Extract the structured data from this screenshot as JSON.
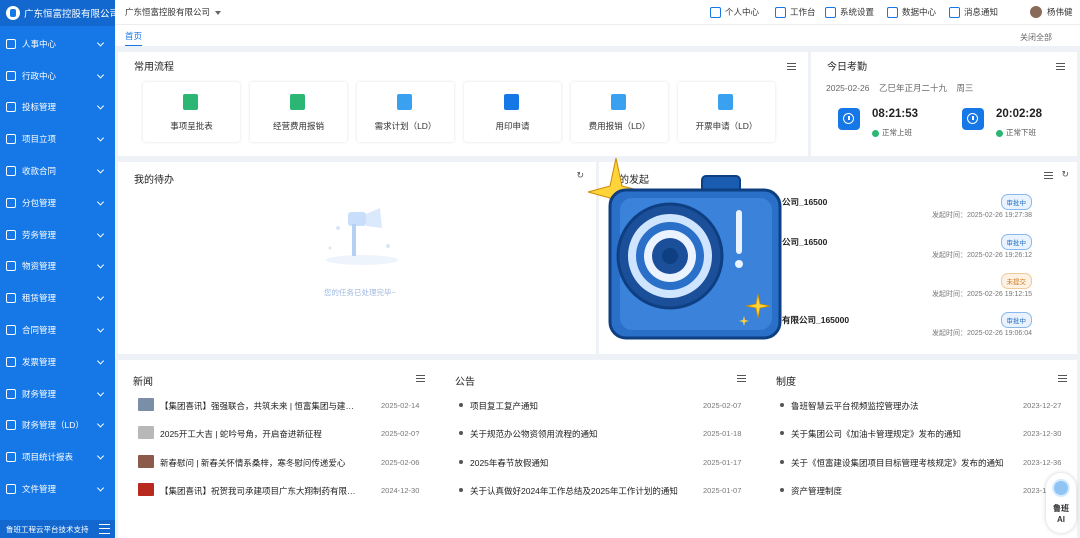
{
  "sidebar": {
    "org_title": "广东恒富控股有限公司",
    "items": [
      {
        "label": "人事中心",
        "icon": "person-icon"
      },
      {
        "label": "行政中心",
        "icon": "admin-icon"
      },
      {
        "label": "投标管理",
        "icon": "bid-icon"
      },
      {
        "label": "项目立项",
        "icon": "project-icon"
      },
      {
        "label": "收款合同",
        "icon": "contract-icon"
      },
      {
        "label": "分包管理",
        "icon": "subcontract-icon"
      },
      {
        "label": "劳务管理",
        "icon": "labor-icon"
      },
      {
        "label": "物资管理",
        "icon": "materials-icon"
      },
      {
        "label": "租赁管理",
        "icon": "lease-icon"
      },
      {
        "label": "合同管理",
        "icon": "contract-mgmt-icon"
      },
      {
        "label": "发票管理",
        "icon": "invoice-icon"
      },
      {
        "label": "财务管理",
        "icon": "finance-icon"
      },
      {
        "label": "财务管理（LD）",
        "icon": "finance-ld-icon"
      },
      {
        "label": "项目统计报表",
        "icon": "report-icon"
      },
      {
        "label": "文件管理",
        "icon": "file-icon"
      }
    ],
    "footer": "鲁班工程云平台技术支持"
  },
  "topbar": {
    "company": "广东恒富控股有限公司",
    "nav": [
      "个人中心",
      "工作台",
      "系统设置",
      "数据中心",
      "消息通知"
    ],
    "user": "杨伟健"
  },
  "tabs": {
    "home": "首页",
    "close_all": "关闭全部"
  },
  "processes": {
    "title": "常用流程",
    "items": [
      {
        "label": "事项呈批表",
        "color": "#2bb673"
      },
      {
        "label": "经营费用报销",
        "color": "#2bb673"
      },
      {
        "label": "需求计划（LD）",
        "color": "#3aa0f0"
      },
      {
        "label": "用印申请",
        "color": "#1677e6"
      },
      {
        "label": "费用报销（LD）",
        "color": "#3aa0f0"
      },
      {
        "label": "开票申请（LD）",
        "color": "#3aa0f0"
      }
    ]
  },
  "attendance": {
    "title": "今日考勤",
    "date": "2025-02-26",
    "lunar": "乙巳年正月二十九",
    "weekday": "周三",
    "checkin": {
      "time": "08:21:53",
      "status": "正常上班"
    },
    "checkout": {
      "time": "20:02:28",
      "status": "正常下班"
    }
  },
  "todo": {
    "title": "我的待办",
    "empty": "您的任务已处理完毕~"
  },
  "sent": {
    "title_visible": "的发起",
    "rows": [
      {
        "title": "公司_16500",
        "badge": "审批中",
        "badge_type": "normal",
        "time": "发起时间：2025-02-26 19:27:38"
      },
      {
        "title": "公司_16500",
        "badge": "审批中",
        "badge_type": "normal",
        "time": "发起时间：2025-02-26 19:26:12"
      },
      {
        "title": "",
        "badge": "未提交",
        "badge_type": "warn",
        "time": "发起时间：2025-02-26 19:12:15"
      },
      {
        "title": "有限公司_165000",
        "badge": "审批中",
        "badge_type": "normal",
        "time": "发起时间：2025-02-26 19:06:04"
      }
    ]
  },
  "news": {
    "title": "新闻",
    "rows": [
      {
        "text": "【集团喜讯】强强联合，共筑未来 | 恒富集团与建成资...",
        "date": "2025-02-14",
        "thumb": "#7a8ea8"
      },
      {
        "text": "2025开工大吉 | 蛇吟号角，开启奋进新征程",
        "date": "2025-02-0?",
        "thumb": "#b8b8b8"
      },
      {
        "text": "新春慰问 | 新春关怀情系桑梓，寒冬慰问传递爱心",
        "date": "2025-02-06",
        "thumb": "#8b5a4a"
      },
      {
        "text": "【集团喜讯】祝贺我司承建项目广东大翔制药有限公司...",
        "date": "2024-12-30",
        "thumb": "#b82a1e"
      }
    ]
  },
  "notice": {
    "title": "公告",
    "rows": [
      {
        "text": "项目复工复产通知",
        "date": "2025-02-07"
      },
      {
        "text": "关于规范办公物资领用流程的通知",
        "date": "2025-01-18"
      },
      {
        "text": "2025年春节放假通知",
        "date": "2025-01-17"
      },
      {
        "text": "关于认真做好2024年工作总结及2025年工作计划的通知",
        "date": "2025-01-07"
      }
    ]
  },
  "policy": {
    "title": "制度",
    "rows": [
      {
        "text": "鲁班智慧云平台视频监控管理办法",
        "date": "2023-12-27"
      },
      {
        "text": "关于集团公司《加油卡管理规定》发布的通知",
        "date": "2023-12-30"
      },
      {
        "text": "关于《恒富建设集团项目目标管理考核规定》发布的通知",
        "date": "2023-12-36"
      },
      {
        "text": "资产管理制度",
        "date": "2023-12-"
      }
    ]
  },
  "ai_assistant": {
    "label": "鲁班\nAI"
  }
}
